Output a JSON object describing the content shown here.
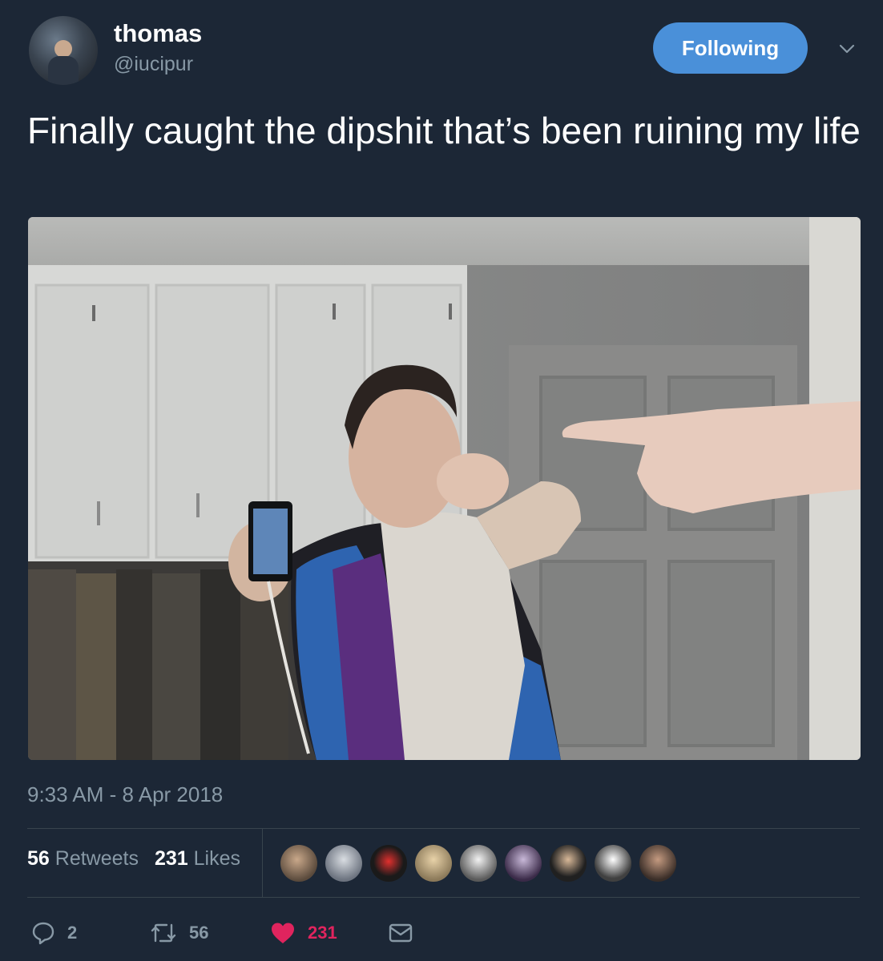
{
  "author": {
    "name": "thomas",
    "handle": "@iucipur"
  },
  "follow_button": {
    "label": "Following",
    "color": "#4a90d9"
  },
  "menu_icon": "chevron-down-icon",
  "tweet": {
    "text": "Finally caught the dipshit that’s been ruining my life",
    "timestamp": "9:33 AM - 8 Apr 2018"
  },
  "stats": {
    "retweets_count": "56",
    "retweets_label": "Retweets",
    "likes_count": "231",
    "likes_label": "Likes",
    "liker_avatar_count": 9
  },
  "actions": {
    "reply_count": "2",
    "retweet_count": "56",
    "like_count": "231",
    "like_color": "#e0245e",
    "icons": [
      "reply-icon",
      "retweet-icon",
      "heart-icon",
      "message-icon"
    ]
  }
}
